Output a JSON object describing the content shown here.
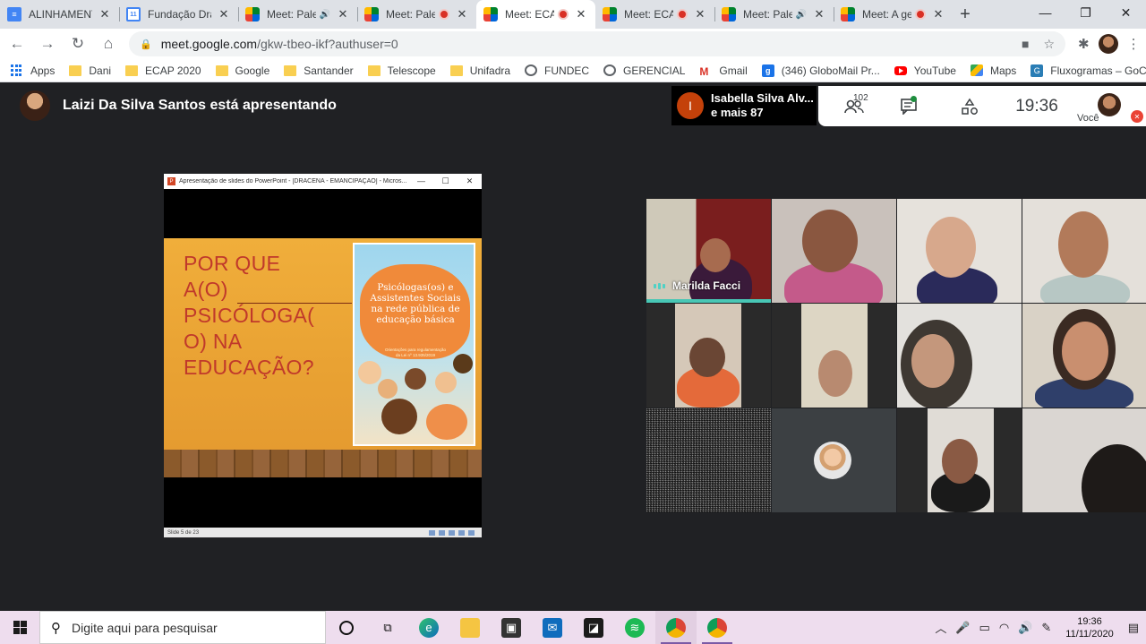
{
  "browser": {
    "tabs": [
      {
        "title": "ALINHAMENTO",
        "icon": "docs",
        "status": "none",
        "active": false
      },
      {
        "title": "Fundação Dracenense",
        "icon": "calendar",
        "status": "none",
        "active": false
      },
      {
        "title": "Meet: Palestra",
        "icon": "meet",
        "status": "audio",
        "active": false
      },
      {
        "title": "Meet: Palestra",
        "icon": "meet",
        "status": "recording",
        "active": false
      },
      {
        "title": "Meet: ECAP",
        "icon": "meet",
        "status": "recording",
        "active": true
      },
      {
        "title": "Meet: ECAP",
        "icon": "meet",
        "status": "recording",
        "active": false
      },
      {
        "title": "Meet: Palestra",
        "icon": "meet",
        "status": "audio",
        "active": false
      },
      {
        "title": "Meet: A gestão",
        "icon": "meet",
        "status": "recording",
        "active": false
      }
    ],
    "calendar_day": "11",
    "url_host": "meet.google.com",
    "url_path": "/gkw-tbeo-ikf?authuser=0",
    "bookmarks": [
      {
        "label": "Apps",
        "icon": "apps"
      },
      {
        "label": "Dani",
        "icon": "folder"
      },
      {
        "label": "ECAP 2020",
        "icon": "folder"
      },
      {
        "label": "Google",
        "icon": "folder"
      },
      {
        "label": "Santander",
        "icon": "folder"
      },
      {
        "label": "Telescope",
        "icon": "folder"
      },
      {
        "label": "Unifadra",
        "icon": "folder"
      },
      {
        "label": "FUNDEC",
        "icon": "globe"
      },
      {
        "label": "GERENCIAL",
        "icon": "globe"
      },
      {
        "label": "Gmail",
        "icon": "gmail"
      },
      {
        "label": "(346) GloboMail Pr...",
        "icon": "globomail"
      },
      {
        "label": "YouTube",
        "icon": "youtube"
      },
      {
        "label": "Maps",
        "icon": "maps"
      },
      {
        "label": "Fluxogramas – GoC...",
        "icon": "fluxogramas"
      }
    ]
  },
  "meet": {
    "presenter_text": "Laizi Da Silva Santos está apresentando",
    "participant_chip": {
      "initial": "I",
      "line1": "Isabella Silva Alv...",
      "line2": "e mais 87"
    },
    "people_count": "102",
    "clock": "19:36",
    "self_label": "Você",
    "accent_color": "#48c7b5",
    "presentation": {
      "window_title": "Apresentação de slides do PowerPoint - [DRACENA - EMANCIPAÇÃO] - Micros...",
      "heading_lines": [
        "POR QUE",
        "A(O)",
        "PSICÓLOGA(",
        "O) NA",
        "EDUCAÇÃO?"
      ],
      "book_title_lines": [
        "Psicólogas(os) e",
        "Assistentes Sociais",
        "na rede pública de",
        "educação básica"
      ],
      "book_subtitle_lines": [
        "Orientações para regulamentação",
        "da Lei nº 13.935/2019"
      ],
      "status_text": "Slide 5 de 23"
    },
    "tiles": [
      {
        "name": "Marilda Facci",
        "speaking": true
      },
      {
        "name": ""
      },
      {
        "name": ""
      },
      {
        "name": ""
      },
      {
        "name": ""
      },
      {
        "name": ""
      },
      {
        "name": ""
      },
      {
        "name": ""
      },
      {
        "name": ""
      },
      {
        "name": ""
      },
      {
        "name": ""
      },
      {
        "name": ""
      }
    ]
  },
  "taskbar": {
    "search_placeholder": "Digite aqui para pesquisar",
    "time": "19:36",
    "date": "11/11/2020"
  }
}
